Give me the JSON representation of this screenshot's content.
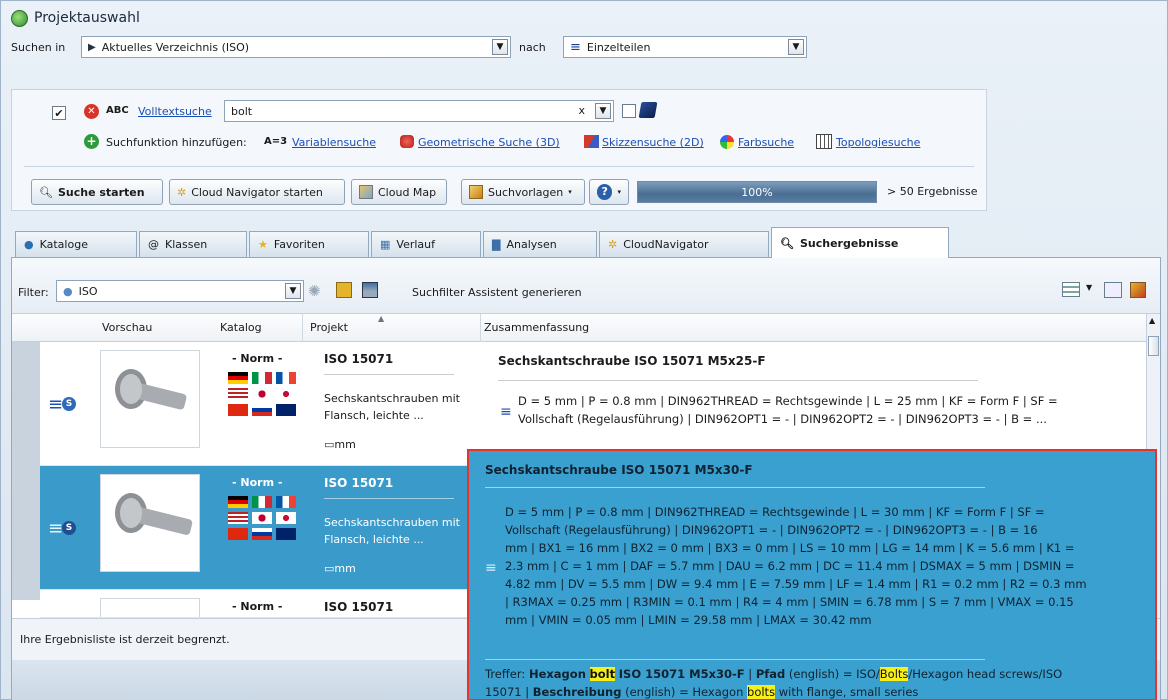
{
  "window": {
    "title": "Projektauswahl"
  },
  "search_bar": {
    "label_in": "Suchen in",
    "scope_value": "Aktuelles Verzeichnis (ISO)",
    "label_by": "nach",
    "by_value": "Einzelteilen"
  },
  "fulltext": {
    "abc_label": "ABC",
    "link": "Volltextsuche",
    "query": "bolt",
    "clear": "x"
  },
  "add_search": {
    "label": "Suchfunktion hinzufügen:",
    "var_prefix": "A=3",
    "options": [
      "Variablensuche",
      "Geometrische Suche (3D)",
      "Skizzensuche (2D)",
      "Farbsuche",
      "Topologiesuche"
    ]
  },
  "toolbar": {
    "start": "Suche starten",
    "cloud_nav": "Cloud Navigator starten",
    "cloud_map": "Cloud Map",
    "templates": "Suchvorlagen",
    "help": "?",
    "progress": "100%",
    "progress_value": 100,
    "results": "> 50 Ergebnisse"
  },
  "tabs": [
    {
      "label": "Kataloge"
    },
    {
      "label": "Klassen"
    },
    {
      "label": "Favoriten"
    },
    {
      "label": "Verlauf"
    },
    {
      "label": "Analysen"
    },
    {
      "label": "CloudNavigator"
    },
    {
      "label": "Suchergebnisse"
    }
  ],
  "filter": {
    "label": "Filter:",
    "value": "ISO",
    "assistant": "Suchfilter Assistent generieren"
  },
  "columns": [
    "Vorschau",
    "Katalog",
    "Projekt",
    "Zusammenfassung"
  ],
  "rows": [
    {
      "catalog": "- Norm -",
      "project": "ISO 15071",
      "description": "Sechskantschrauben mit Flansch, leichte ...",
      "unit": "mm",
      "summary_title": "Sechskantschraube ISO 15071 M5x25-F",
      "summary_line1": "D = 5 mm | P = 0.8 mm | DIN962THREAD = Rechtsgewinde | L = 25 mm | KF = Form F | SF =",
      "summary_line2": "Vollschaft (Regelausführung) | DIN962OPT1 = - | DIN962OPT2 = - | DIN962OPT3 = - | B = ..."
    },
    {
      "catalog": "- Norm -",
      "project": "ISO 15071",
      "description": "Sechskantschrauben mit Flansch, leichte ...",
      "unit": "mm"
    },
    {
      "catalog": "- Norm -",
      "project": "ISO 15071"
    }
  ],
  "status": "Ihre Ergebnisliste ist derzeit begrenzt.",
  "tooltip": {
    "title": "Sechskantschraube ISO 15071 M5x30-F",
    "lines": [
      "D = 5 mm | P = 0.8 mm | DIN962THREAD = Rechtsgewinde | L = 30 mm | KF = Form F | SF =",
      "Vollschaft (Regelausführung) | DIN962OPT1 = - | DIN962OPT2 = - | DIN962OPT3 = - | B = 16",
      "mm | BX1 = 16 mm | BX2 = 0 mm | BX3 = 0 mm | LS = 10 mm | LG = 14 mm | K = 5.6 mm | K1 =",
      "2.3 mm | C = 1 mm | DAF = 5.7 mm | DAU = 6.2 mm | DC = 11.4 mm | DSMAX = 5 mm | DSMIN =",
      "4.82 mm | DV = 5.5 mm | DW = 9.4 mm | E = 7.59 mm | LF = 1.4 mm | R1 = 0.2 mm | R2 = 0.3 mm",
      "| R3MAX = 0.25 mm | R3MIN = 0.1 mm | R4 = 4 mm | SMIN = 6.78 mm | S = 7 mm | VMAX = 0.15",
      "mm | VMIN = 0.05 mm | LMIN = 29.58 mm | LMAX = 30.42 mm"
    ],
    "hit_label": "Treffer:",
    "hit_text_a": "Hexagon",
    "hit_highlight_1": "bolt",
    "hit_text_b": "ISO 15071 M5x30-F",
    "path_label": "Pfad",
    "path_suffix": "(english) = ISO/",
    "path_highlight": "Bolts",
    "path_rest": "/Hexagon head screws/ISO",
    "line2_prefix": "15071 |",
    "desc_label": "Beschreibung",
    "desc_mid": "(english) = Hexagon",
    "desc_highlight": "bolts",
    "desc_rest": "with flange, small series"
  },
  "colors": {
    "selection": "#3a9bcb",
    "tooltip_border": "#e8332b",
    "highlight": "#f7ef1c",
    "link": "#1b4fb3"
  }
}
